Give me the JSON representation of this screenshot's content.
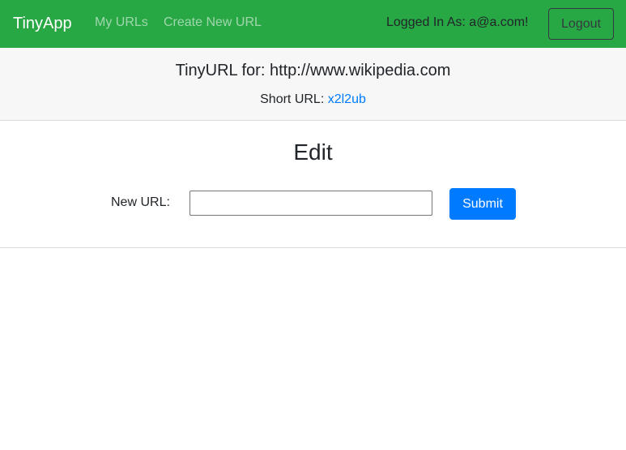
{
  "nav": {
    "brand": "TinyApp",
    "links": [
      "My URLs",
      "Create New URL"
    ],
    "logged_in_text": "Logged In As: a@a.com!",
    "logout_label": "Logout"
  },
  "header": {
    "title": "TinyURL for: http://www.wikipedia.com",
    "short_url_label": "Short URL: ",
    "short_url_value": "x2l2ub"
  },
  "edit": {
    "title": "Edit",
    "field_label": "New URL:",
    "field_value": "",
    "submit_label": "Submit"
  },
  "colors": {
    "navbar": "#28a745",
    "link": "#007bff",
    "primary_button": "#007bff"
  }
}
